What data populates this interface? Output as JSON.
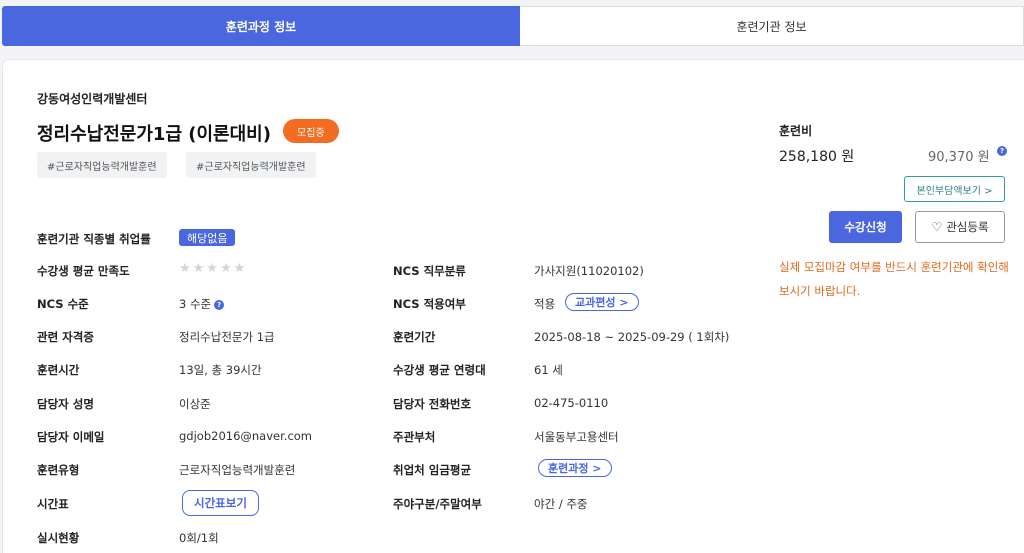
{
  "tabs": [
    {
      "label": "훈련과정 정보"
    },
    {
      "label": "훈련기관 정보"
    }
  ],
  "course": {
    "institution": "강동여성인력개발센터",
    "title": "정리수납전문가1급 (이론대비)",
    "status_badge": "모집중",
    "hashtags": [
      "#근로자직업능력개발훈련",
      "#근로자직업능력개발훈련"
    ]
  },
  "details": {
    "employment_rate": {
      "label": "훈련기관 직종별 취업률",
      "value": "해당없음"
    },
    "satisfaction": {
      "label": "수강생 평균 만족도",
      "stars": "★★★★★",
      "rating": 0
    },
    "ncs_level": {
      "label": "NCS 수준",
      "value": "3 수준"
    },
    "certificate": {
      "label": "관련 자격증",
      "value": "정리수납전문가 1급"
    },
    "training_hours": {
      "label": "훈련시간",
      "value": "13일, 총 39시간"
    },
    "manager_name": {
      "label": "담당자 성명",
      "value": "이상준"
    },
    "manager_email": {
      "label": "담당자 이메일",
      "value": "gdjob2016@naver.com"
    },
    "training_type": {
      "label": "훈련유형",
      "value": "근로자직업능력개발훈련"
    },
    "timetable": {
      "label": "시간표",
      "button": "시간표보기"
    },
    "status": {
      "label": "실시현황",
      "value": "0회/1회"
    },
    "ncs_category": {
      "label": "NCS 직무분류",
      "value": "가사지원(11020102)"
    },
    "ncs_applied": {
      "label": "NCS 적용여부",
      "value": "적용",
      "button": "교과편성 >"
    },
    "training_period": {
      "label": "훈련기간",
      "value": "2025-08-18 ~ 2025-09-29 ( 1회차)"
    },
    "avg_age": {
      "label": "수강생 평균 연령대",
      "value": "61 세"
    },
    "manager_phone": {
      "label": "담당자 전화번호",
      "value": "02-475-0110"
    },
    "authority": {
      "label": "주관부처",
      "value": "서울동부고용센터"
    },
    "wage": {
      "label": "취업처 임금평균",
      "button": "훈련과정 >"
    },
    "day_night": {
      "label": "주야구분/주말여부",
      "value": "야간 / 주중"
    }
  },
  "fee": {
    "label": "훈련비",
    "total": "258,180 원",
    "self_pay": "90,370 원",
    "info_icon": "?",
    "self_pay_button": "본인부담액보기 >",
    "apply_button": "수강신청",
    "favorite_button": "관심등록",
    "notice": "실제 모집마감 여부를 반드시 훈련기관에 확인해보시기 바랍니다."
  },
  "colors": {
    "accent": "#4a67e0",
    "badge": "#f26d21",
    "notice": "#e06a1c"
  }
}
